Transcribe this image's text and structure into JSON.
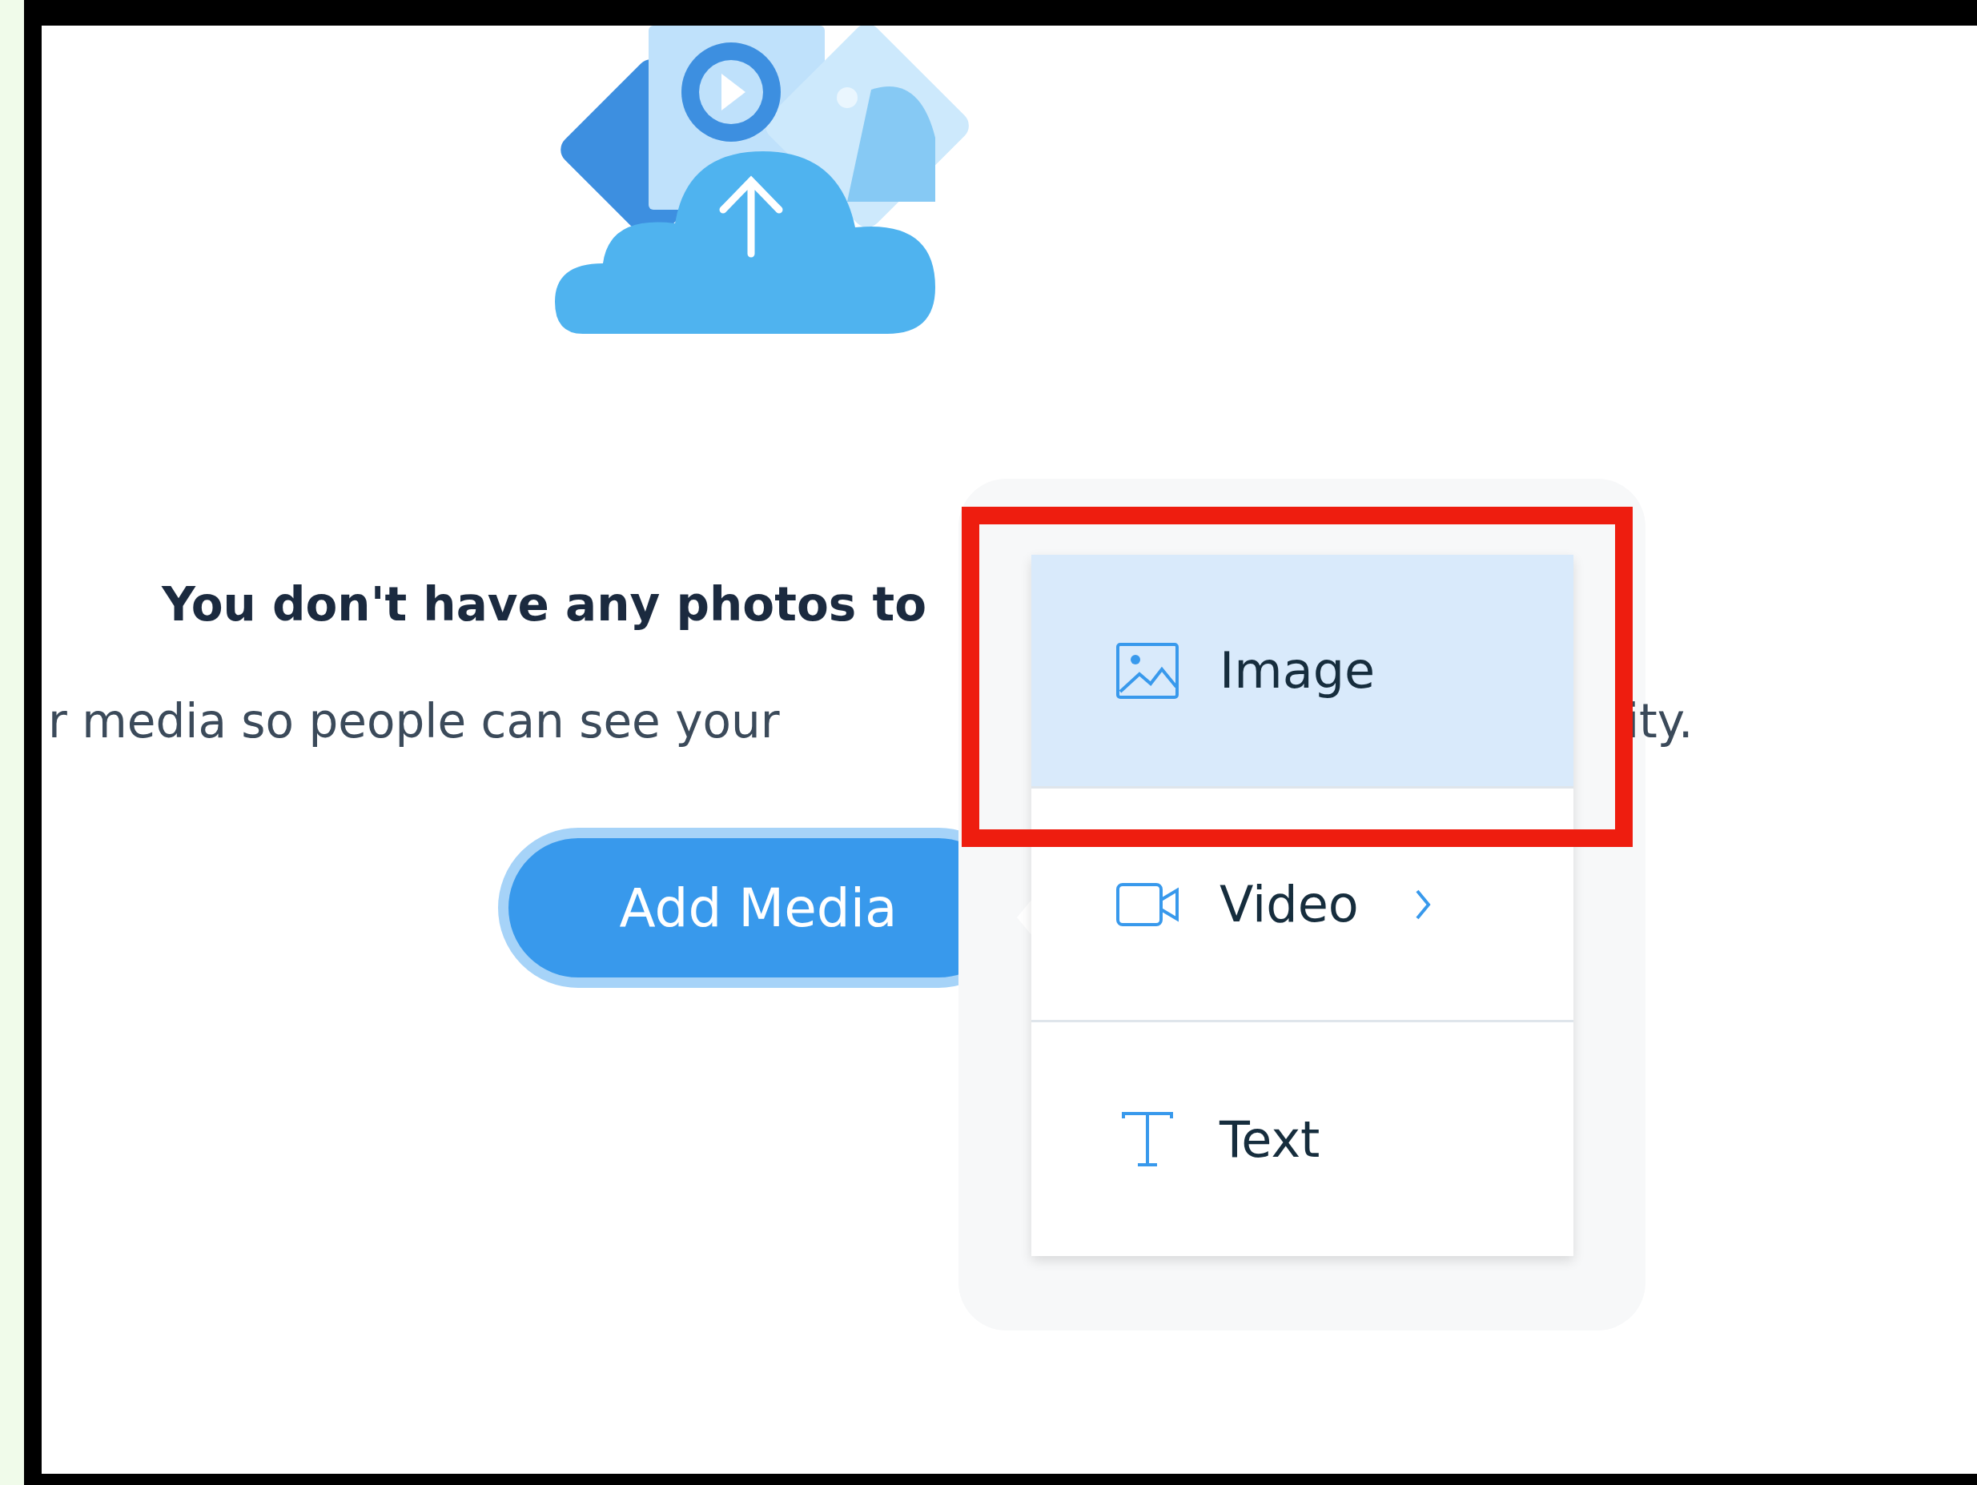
{
  "empty_state": {
    "heading": "You don't have any photos to",
    "description_start": "r media so people can see your",
    "description_end": "ity."
  },
  "add_media_button": {
    "label": "Add Media"
  },
  "media_menu": {
    "items": [
      {
        "label": "Image",
        "selected": true,
        "has_submenu": false
      },
      {
        "label": "Video",
        "selected": false,
        "has_submenu": true
      },
      {
        "label": "Text",
        "selected": false,
        "has_submenu": false
      }
    ]
  },
  "annotation": {
    "highlight": true
  }
}
